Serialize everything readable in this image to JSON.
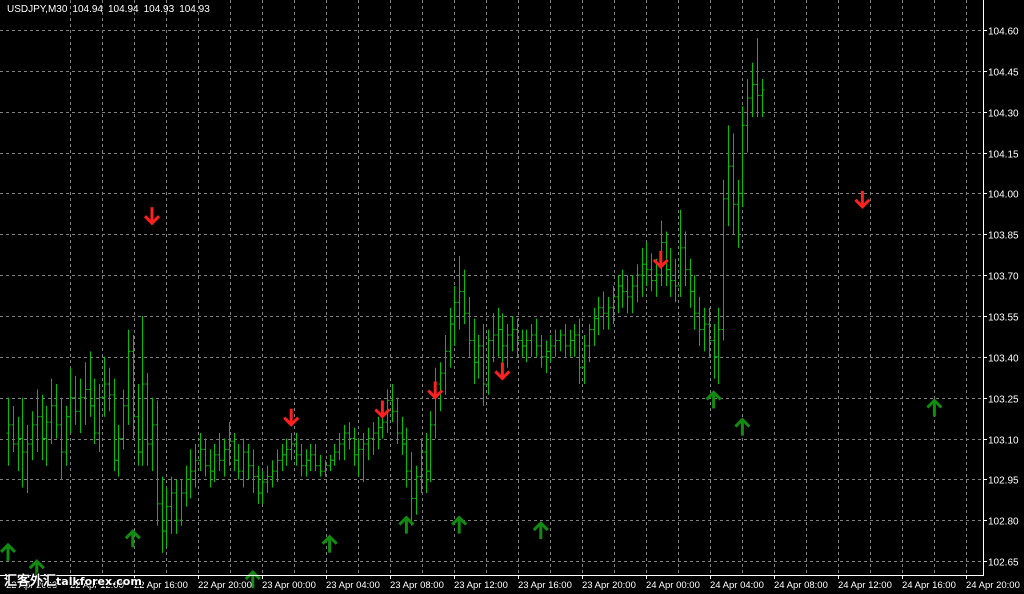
{
  "header": {
    "symbol": "USDJPY,M30",
    "open": "104.94",
    "high": "104.94",
    "low": "104.93",
    "close": "104.93"
  },
  "watermark": {
    "cjk": "汇客外汇",
    "latin": "talkforex.com"
  },
  "colors": {
    "background": "#000000",
    "bars": "#00c000",
    "grid": "#7f7f7f",
    "axis_text": "#ffffff",
    "sell_arrow": "#ff2020",
    "buy_arrow": "#118c11"
  },
  "chart_data": {
    "type": "ohlc",
    "timeframe": "M30",
    "ylim": [
      102.6,
      104.62
    ],
    "price_ticks": [
      "104.60",
      "104.45",
      "104.30",
      "104.15",
      "104.00",
      "103.85",
      "103.70",
      "103.55",
      "103.40",
      "103.25",
      "103.10",
      "102.95",
      "102.80",
      "102.65"
    ],
    "time_ticks": [
      "22 Apr 2008",
      "22 Apr 12:00",
      "22 Apr 16:00",
      "22 Apr 20:00",
      "23 Apr 00:00",
      "23 Apr 04:00",
      "23 Apr 08:00",
      "23 Apr 12:00",
      "23 Apr 16:00",
      "23 Apr 20:00",
      "24 Apr 00:00",
      "24 Apr 04:00",
      "24 Apr 08:00",
      "24 Apr 12:00",
      "24 Apr 16:00",
      "24 Apr 20:00"
    ],
    "bar_count": 161,
    "bars": [
      [
        103.12,
        103.25,
        103.0,
        103.15
      ],
      [
        103.15,
        103.22,
        103.05,
        103.08
      ],
      [
        103.08,
        103.18,
        102.98,
        103.1
      ],
      [
        103.1,
        103.25,
        102.92,
        103.05
      ],
      [
        103.05,
        103.15,
        102.9,
        103.08
      ],
      [
        103.08,
        103.2,
        103.02,
        103.15
      ],
      [
        103.15,
        103.28,
        103.05,
        103.18
      ],
      [
        103.18,
        103.26,
        103.02,
        103.1
      ],
      [
        103.1,
        103.22,
        103.0,
        103.16
      ],
      [
        103.16,
        103.32,
        103.08,
        103.22
      ],
      [
        103.22,
        103.3,
        103.1,
        103.15
      ],
      [
        103.15,
        103.25,
        102.95,
        103.05
      ],
      [
        103.05,
        103.22,
        103.0,
        103.18
      ],
      [
        103.18,
        103.36,
        103.12,
        103.25
      ],
      [
        103.25,
        103.33,
        103.15,
        103.2
      ],
      [
        103.2,
        103.32,
        103.12,
        103.25
      ],
      [
        103.25,
        103.38,
        103.15,
        103.28
      ],
      [
        103.28,
        103.42,
        103.18,
        103.22
      ],
      [
        103.22,
        103.32,
        103.08,
        103.12
      ],
      [
        103.12,
        103.3,
        103.05,
        103.25
      ],
      [
        103.25,
        103.4,
        103.18,
        103.3
      ],
      [
        103.3,
        103.36,
        103.2,
        103.26
      ],
      [
        103.26,
        103.32,
        102.98,
        103.02
      ],
      [
        103.02,
        103.15,
        102.96,
        103.1
      ],
      [
        103.1,
        103.28,
        103.06,
        103.22
      ],
      [
        103.22,
        103.5,
        103.15,
        103.42
      ],
      [
        103.42,
        103.48,
        103.1,
        103.18
      ],
      [
        103.18,
        103.3,
        103.0,
        103.05
      ],
      [
        103.05,
        103.55,
        103.0,
        103.3
      ],
      [
        103.3,
        103.34,
        103.0,
        103.08
      ],
      [
        103.08,
        103.25,
        102.98,
        103.15
      ],
      [
        103.15,
        103.24,
        102.78,
        102.86
      ],
      [
        102.86,
        102.96,
        102.68,
        102.76
      ],
      [
        102.76,
        102.92,
        102.7,
        102.85
      ],
      [
        102.85,
        102.96,
        102.75,
        102.9
      ],
      [
        102.9,
        102.95,
        102.75,
        102.8
      ],
      [
        102.8,
        102.95,
        102.78,
        102.9
      ],
      [
        102.9,
        103.0,
        102.85,
        102.95
      ],
      [
        102.95,
        103.06,
        102.88,
        102.98
      ],
      [
        102.98,
        103.08,
        102.92,
        103.02
      ],
      [
        103.02,
        103.12,
        102.98,
        103.06
      ],
      [
        103.06,
        103.1,
        102.96,
        103.0
      ],
      [
        103.0,
        103.06,
        102.92,
        102.98
      ],
      [
        102.98,
        103.08,
        102.94,
        103.04
      ],
      [
        103.04,
        103.12,
        102.98,
        103.02
      ],
      [
        103.02,
        103.1,
        102.96,
        103.06
      ],
      [
        103.06,
        103.16,
        103.0,
        103.09
      ],
      [
        103.09,
        103.12,
        102.98,
        103.02
      ],
      [
        103.02,
        103.08,
        102.95,
        102.98
      ],
      [
        102.98,
        103.1,
        102.92,
        103.05
      ],
      [
        103.05,
        103.08,
        102.95,
        103.0
      ],
      [
        103.0,
        103.06,
        102.9,
        102.96
      ],
      [
        102.96,
        103.0,
        102.86,
        102.9
      ],
      [
        102.9,
        102.98,
        102.86,
        102.94
      ],
      [
        102.94,
        103.0,
        102.9,
        102.96
      ],
      [
        102.96,
        103.02,
        102.92,
        102.98
      ],
      [
        102.98,
        103.06,
        102.94,
        103.02
      ],
      [
        103.02,
        103.08,
        102.98,
        103.04
      ],
      [
        103.04,
        103.1,
        103.0,
        103.06
      ],
      [
        103.06,
        103.12,
        103.02,
        103.08
      ],
      [
        103.08,
        103.12,
        103.0,
        103.04
      ],
      [
        103.04,
        103.08,
        102.96,
        103.0
      ],
      [
        103.0,
        103.06,
        102.96,
        103.02
      ],
      [
        103.02,
        103.08,
        102.98,
        103.04
      ],
      [
        103.04,
        103.08,
        102.98,
        103.0
      ],
      [
        103.0,
        103.04,
        102.96,
        102.98
      ],
      [
        102.98,
        103.02,
        102.96,
        103.0
      ],
      [
        103.0,
        103.04,
        102.98,
        103.02
      ],
      [
        103.02,
        103.08,
        103.0,
        103.05
      ],
      [
        103.05,
        103.12,
        103.02,
        103.08
      ],
      [
        103.08,
        103.15,
        103.02,
        103.12
      ],
      [
        103.12,
        103.16,
        103.06,
        103.1
      ],
      [
        103.1,
        103.14,
        103.0,
        103.04
      ],
      [
        103.04,
        103.1,
        102.96,
        103.06
      ],
      [
        103.06,
        103.12,
        102.94,
        103.08
      ],
      [
        103.08,
        103.14,
        103.02,
        103.1
      ],
      [
        103.1,
        103.16,
        103.04,
        103.12
      ],
      [
        103.12,
        103.18,
        103.06,
        103.14
      ],
      [
        103.14,
        103.2,
        103.1,
        103.16
      ],
      [
        103.16,
        103.28,
        103.12,
        103.24
      ],
      [
        103.24,
        103.3,
        103.16,
        103.2
      ],
      [
        103.2,
        103.25,
        103.08,
        103.12
      ],
      [
        103.12,
        103.18,
        103.04,
        103.08
      ],
      [
        103.08,
        103.14,
        102.92,
        102.98
      ],
      [
        102.98,
        103.05,
        102.78,
        102.88
      ],
      [
        102.88,
        103.0,
        102.82,
        102.96
      ],
      [
        102.96,
        103.1,
        102.9,
        103.05
      ],
      [
        103.05,
        103.12,
        102.9,
        102.98
      ],
      [
        102.98,
        103.2,
        102.94,
        103.15
      ],
      [
        103.15,
        103.36,
        103.1,
        103.3
      ],
      [
        103.3,
        103.38,
        103.2,
        103.34
      ],
      [
        103.34,
        103.48,
        103.26,
        103.42
      ],
      [
        103.42,
        103.58,
        103.36,
        103.52
      ],
      [
        103.52,
        103.66,
        103.44,
        103.6
      ],
      [
        103.6,
        103.77,
        103.5,
        103.64
      ],
      [
        103.64,
        103.72,
        103.52,
        103.56
      ],
      [
        103.56,
        103.62,
        103.4,
        103.46
      ],
      [
        103.46,
        103.54,
        103.3,
        103.38
      ],
      [
        103.38,
        103.48,
        103.32,
        103.44
      ],
      [
        103.44,
        103.52,
        103.22,
        103.3
      ],
      [
        103.3,
        103.5,
        103.26,
        103.46
      ],
      [
        103.46,
        103.56,
        103.38,
        103.48
      ],
      [
        103.48,
        103.58,
        103.4,
        103.5
      ],
      [
        103.5,
        103.56,
        103.38,
        103.44
      ],
      [
        103.44,
        103.52,
        103.36,
        103.48
      ],
      [
        103.48,
        103.55,
        103.42,
        103.5
      ],
      [
        103.5,
        103.54,
        103.4,
        103.46
      ],
      [
        103.46,
        103.5,
        103.4,
        103.44
      ],
      [
        103.44,
        103.5,
        103.38,
        103.46
      ],
      [
        103.46,
        103.52,
        103.4,
        103.48
      ],
      [
        103.48,
        103.54,
        103.4,
        103.44
      ],
      [
        103.44,
        103.48,
        103.36,
        103.4
      ],
      [
        103.4,
        103.46,
        103.34,
        103.42
      ],
      [
        103.42,
        103.48,
        103.38,
        103.44
      ],
      [
        103.44,
        103.5,
        103.4,
        103.46
      ],
      [
        103.46,
        103.5,
        103.42,
        103.48
      ],
      [
        103.48,
        103.52,
        103.4,
        103.44
      ],
      [
        103.44,
        103.5,
        103.4,
        103.46
      ],
      [
        103.46,
        103.52,
        103.4,
        103.48
      ],
      [
        103.48,
        103.54,
        103.3,
        103.36
      ],
      [
        103.36,
        103.48,
        103.3,
        103.44
      ],
      [
        103.44,
        103.52,
        103.38,
        103.5
      ],
      [
        103.5,
        103.58,
        103.44,
        103.54
      ],
      [
        103.54,
        103.62,
        103.48,
        103.58
      ],
      [
        103.58,
        103.64,
        103.5,
        103.56
      ],
      [
        103.56,
        103.62,
        103.5,
        103.58
      ],
      [
        103.58,
        103.66,
        103.52,
        103.62
      ],
      [
        103.62,
        103.7,
        103.56,
        103.66
      ],
      [
        103.66,
        103.72,
        103.58,
        103.64
      ],
      [
        103.64,
        103.7,
        103.56,
        103.62
      ],
      [
        103.62,
        103.7,
        103.56,
        103.66
      ],
      [
        103.66,
        103.74,
        103.6,
        103.7
      ],
      [
        103.7,
        103.8,
        103.62,
        103.74
      ],
      [
        103.74,
        103.82,
        103.66,
        103.72
      ],
      [
        103.72,
        103.78,
        103.64,
        103.68
      ],
      [
        103.68,
        103.76,
        103.62,
        103.7
      ],
      [
        103.7,
        103.9,
        103.66,
        103.82
      ],
      [
        103.82,
        103.86,
        103.66,
        103.72
      ],
      [
        103.72,
        103.8,
        103.62,
        103.68
      ],
      [
        103.68,
        103.76,
        103.6,
        103.66
      ],
      [
        103.66,
        103.94,
        103.62,
        103.8
      ],
      [
        103.8,
        103.86,
        103.66,
        103.72
      ],
      [
        103.72,
        103.76,
        103.58,
        103.64
      ],
      [
        103.64,
        103.7,
        103.5,
        103.56
      ],
      [
        103.56,
        103.62,
        103.44,
        103.5
      ],
      [
        103.5,
        103.58,
        103.42,
        103.52
      ],
      [
        103.52,
        103.58,
        103.4,
        103.46
      ],
      [
        103.46,
        103.52,
        103.32,
        103.4
      ],
      [
        103.4,
        103.58,
        103.3,
        103.5
      ],
      [
        103.5,
        104.05,
        103.46,
        103.98
      ],
      [
        103.98,
        104.25,
        103.88,
        104.1
      ],
      [
        104.1,
        104.22,
        103.85,
        103.96
      ],
      [
        103.96,
        104.05,
        103.8,
        104.0
      ],
      [
        104.0,
        104.32,
        103.95,
        104.25
      ],
      [
        104.25,
        104.42,
        104.15,
        104.35
      ],
      [
        104.35,
        104.48,
        104.28,
        104.4
      ],
      [
        104.4,
        104.57,
        104.28,
        104.36
      ],
      [
        104.36,
        104.42,
        104.28,
        104.38
      ]
    ],
    "sell_signals": [
      {
        "bar": 30,
        "price": 103.92
      },
      {
        "bar": 59,
        "price": 103.18
      },
      {
        "bar": 78,
        "price": 103.21
      },
      {
        "bar": 89,
        "price": 103.28
      },
      {
        "bar": 103,
        "price": 103.35
      },
      {
        "bar": 136,
        "price": 103.76
      },
      {
        "bar": 178,
        "price": 103.98
      }
    ],
    "buy_signals": [
      {
        "bar": 0,
        "price": 102.68
      },
      {
        "bar": 6,
        "price": 102.62
      },
      {
        "bar": 26,
        "price": 102.73
      },
      {
        "bar": 51,
        "price": 102.58
      },
      {
        "bar": 67,
        "price": 102.71
      },
      {
        "bar": 83,
        "price": 102.78
      },
      {
        "bar": 94,
        "price": 102.78
      },
      {
        "bar": 111,
        "price": 102.76
      },
      {
        "bar": 147,
        "price": 103.24
      },
      {
        "bar": 153,
        "price": 103.14
      },
      {
        "bar": 193,
        "price": 103.21
      }
    ]
  }
}
